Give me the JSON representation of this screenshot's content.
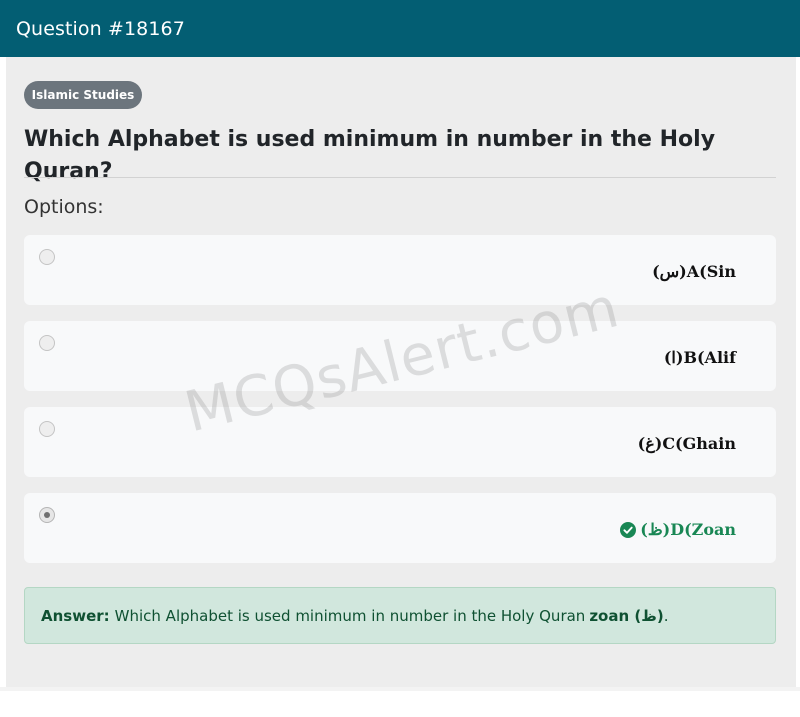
{
  "header": {
    "title": "Question #18167"
  },
  "badge": {
    "label": "Islamic Studies"
  },
  "question": {
    "text": "Which Alphabet is used minimum in number in the Holy Quran?"
  },
  "options_label": "Options:",
  "options": [
    {
      "text": "(س)A(Sin",
      "selected": false,
      "correct": false
    },
    {
      "text": "(ا)B(Alif",
      "selected": false,
      "correct": false
    },
    {
      "text": "(غ)C(Ghain",
      "selected": false,
      "correct": false
    },
    {
      "text": "(ظ)D(Zoan",
      "selected": true,
      "correct": true
    }
  ],
  "answer": {
    "label": "Answer:",
    "text": "Which Alphabet is used minimum in number in the Holy Quran",
    "value": "zoan (ظ)",
    "suffix": "."
  },
  "watermark": "MCQsAlert.com",
  "colors": {
    "header_bg": "#035e73",
    "badge_bg": "#6c757d",
    "correct": "#198754",
    "answer_bg": "#d1e7dd"
  },
  "icons": {
    "correct": "check-circle-icon"
  }
}
